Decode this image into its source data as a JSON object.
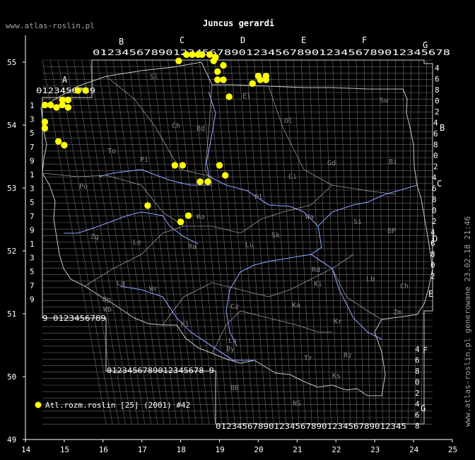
{
  "site": "www.atlas-roslin.pl",
  "title": "Juncus gerardi",
  "generated": "www.atlas-roslin.pl generowane 23.02.18 21:46",
  "legend": {
    "label": "Atl.rozm.roslin [25] (2001) #42",
    "color": "#ffff00"
  },
  "colors": {
    "background": "#000000",
    "grid": "#808080",
    "border": "#d0d0d0",
    "rivers": "#8aa0ff",
    "points": "#ffff00"
  },
  "axes": {
    "x_ticks": [
      "14",
      "15",
      "16",
      "17",
      "18",
      "19",
      "20",
      "21",
      "22",
      "23",
      "24",
      "25"
    ],
    "y_ticks": [
      "55",
      "54",
      "53",
      "52",
      "51",
      "50",
      "49"
    ]
  },
  "grid_labels": {
    "top_row": "0123456789012345678901234567890123456789012345678",
    "top_row2": "0123456789",
    "a_row": "0123456789",
    "bottom_left": "9 0123456789",
    "bottom_mid": "0123456789012345678 9",
    "bottom_right": "012345678901234567890123456789012345",
    "left_col": [
      "1",
      "3",
      "5",
      "7",
      "9",
      "1",
      "3",
      "5",
      "7",
      "9",
      "1",
      "3",
      "5",
      "7",
      "9"
    ],
    "right_col": [
      "4",
      "6",
      "8",
      "0",
      "2",
      "4",
      "6",
      "8",
      "0",
      "2",
      "4",
      "6",
      "8",
      "0",
      "2",
      "4",
      "6",
      "8",
      "0",
      "2"
    ],
    "right_col2": [
      "4",
      "6",
      "8",
      "0",
      "2",
      "4",
      "6",
      "8"
    ]
  },
  "zone_letters": {
    "top": [
      "A",
      "B",
      "C",
      "D",
      "E",
      "F",
      "G"
    ],
    "right": [
      "B",
      "C",
      "D",
      "E",
      "F",
      "G"
    ]
  },
  "regions": [
    "Sl",
    "Ch",
    "El",
    "Ol",
    "Su",
    "Gd",
    "Bi",
    "Pi",
    "Ci",
    "Po",
    "To",
    "Bd",
    "Pl",
    "Ko",
    "Si",
    "BP",
    "Zg",
    "Le",
    "Lu",
    "Sk",
    "Rd",
    "Lb",
    "Ch",
    "Lg",
    "Wr",
    "Op",
    "Ka",
    "Kl",
    "Ki",
    "Zm",
    "Kr",
    "Tr",
    "Rz",
    "Ks",
    "NS",
    "BB",
    "By",
    "Ln",
    "Cz",
    "Ra",
    "Wa",
    "Wb"
  ],
  "points": [
    [
      14.5,
      54.32
    ],
    [
      14.65,
      54.32
    ],
    [
      14.95,
      54.32
    ],
    [
      15.1,
      54.4
    ],
    [
      14.95,
      54.4
    ],
    [
      15.1,
      54.28
    ],
    [
      14.8,
      54.28
    ],
    [
      14.5,
      54.05
    ],
    [
      14.5,
      53.95
    ],
    [
      14.85,
      53.74
    ],
    [
      15.0,
      53.68
    ],
    [
      15.35,
      54.55
    ],
    [
      15.55,
      54.55
    ],
    [
      17.95,
      55.02
    ],
    [
      18.15,
      55.12
    ],
    [
      18.3,
      55.12
    ],
    [
      18.45,
      55.12
    ],
    [
      18.55,
      55.12
    ],
    [
      18.75,
      55.12
    ],
    [
      18.85,
      55.02
    ],
    [
      18.9,
      55.08
    ],
    [
      19.1,
      54.95
    ],
    [
      18.95,
      54.85
    ],
    [
      18.95,
      54.72
    ],
    [
      19.1,
      54.72
    ],
    [
      19.25,
      54.45
    ],
    [
      19.85,
      54.66
    ],
    [
      20.0,
      54.78
    ],
    [
      20.2,
      54.78
    ],
    [
      20.05,
      54.72
    ],
    [
      20.2,
      54.72
    ],
    [
      17.85,
      53.36
    ],
    [
      18.05,
      53.36
    ],
    [
      18.5,
      53.1
    ],
    [
      18.7,
      53.1
    ],
    [
      19.0,
      53.36
    ],
    [
      19.15,
      53.2
    ],
    [
      17.15,
      52.72
    ],
    [
      18.0,
      52.46
    ],
    [
      18.2,
      52.56
    ]
  ]
}
